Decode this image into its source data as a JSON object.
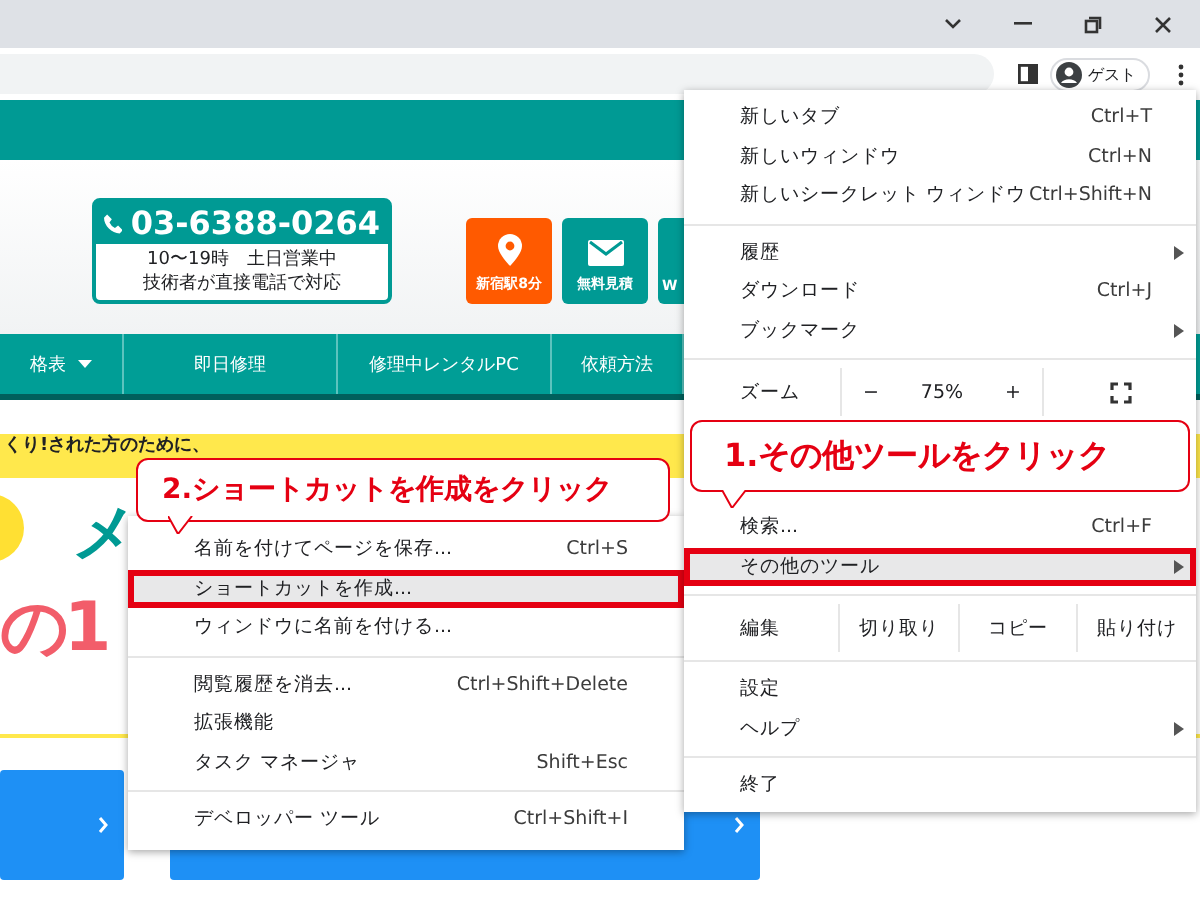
{
  "toolbar": {
    "profile": "ゲスト"
  },
  "site": {
    "phone": "03-6388-0264",
    "hours": "10〜19時　土日営業中",
    "note": "技術者が直接電話で対応",
    "buttons": [
      {
        "label": "新宿駅8分",
        "kind": "location"
      },
      {
        "label": "無料見積",
        "kind": "mail"
      },
      {
        "label": "W",
        "kind": "plain"
      }
    ],
    "nav": [
      {
        "label": "格表",
        "dropdown": true
      },
      {
        "label": "即日修理",
        "dropdown": false
      },
      {
        "label": "修理中レンタルPC",
        "dropdown": false
      },
      {
        "label": "依頼方法",
        "dropdown": false
      }
    ],
    "banner": "くり!された方のために、",
    "hero_mark": "メ",
    "hero_number": "の1"
  },
  "main_menu": {
    "sections": [
      {
        "kind": "items",
        "items": [
          {
            "label": "新しいタブ",
            "shortcut": "Ctrl+T",
            "submenu": false,
            "selected": false
          },
          {
            "label": "新しいウィンドウ",
            "shortcut": "Ctrl+N",
            "submenu": false,
            "selected": false
          },
          {
            "label": "新しいシークレット ウィンドウ",
            "shortcut": "Ctrl+Shift+N",
            "submenu": false,
            "selected": false
          }
        ]
      },
      {
        "kind": "items",
        "items": [
          {
            "label": "履歴",
            "submenu": true,
            "selected": false
          },
          {
            "label": "ダウンロード",
            "shortcut": "Ctrl+J",
            "submenu": false,
            "selected": false
          },
          {
            "label": "ブックマーク",
            "submenu": true,
            "selected": false
          }
        ]
      },
      {
        "kind": "zoom",
        "label": "ズーム",
        "minus": "−",
        "value": "75%",
        "plus": "+"
      },
      {
        "kind": "callout",
        "text": "1.その他ツールをクリック"
      },
      {
        "kind": "items",
        "items": [
          {
            "label": "検索...",
            "shortcut": "Ctrl+F",
            "submenu": false,
            "selected": false
          },
          {
            "label": "その他のツール",
            "submenu": true,
            "selected": true
          }
        ]
      },
      {
        "kind": "edit",
        "label": "編集",
        "actions": [
          "切り取り",
          "コピー",
          "貼り付け"
        ]
      },
      {
        "kind": "items",
        "items": [
          {
            "label": "設定",
            "submenu": false,
            "selected": false
          },
          {
            "label": "ヘルプ",
            "submenu": true,
            "selected": false
          }
        ]
      },
      {
        "kind": "items",
        "items": [
          {
            "label": "終了",
            "submenu": false,
            "selected": false
          }
        ]
      }
    ]
  },
  "sub_menu": {
    "callout": "2.ショートカットを作成をクリック",
    "sections": [
      {
        "kind": "items",
        "items": [
          {
            "label": "名前を付けてページを保存...",
            "shortcut": "Ctrl+S",
            "submenu": false,
            "selected": false
          },
          {
            "label": "ショートカットを作成...",
            "submenu": false,
            "selected": true
          },
          {
            "label": "ウィンドウに名前を付ける...",
            "submenu": false,
            "selected": false
          }
        ]
      },
      {
        "kind": "items",
        "items": [
          {
            "label": "閲覧履歴を消去...",
            "shortcut": "Ctrl+Shift+Delete",
            "submenu": false,
            "selected": false
          },
          {
            "label": "拡張機能",
            "submenu": false,
            "selected": false
          },
          {
            "label": "タスク マネージャ",
            "shortcut": "Shift+Esc",
            "submenu": false,
            "selected": false
          }
        ]
      },
      {
        "kind": "items",
        "items": [
          {
            "label": "デベロッパー ツール",
            "shortcut": "Ctrl+Shift+I",
            "submenu": false,
            "selected": false
          }
        ]
      }
    ]
  }
}
